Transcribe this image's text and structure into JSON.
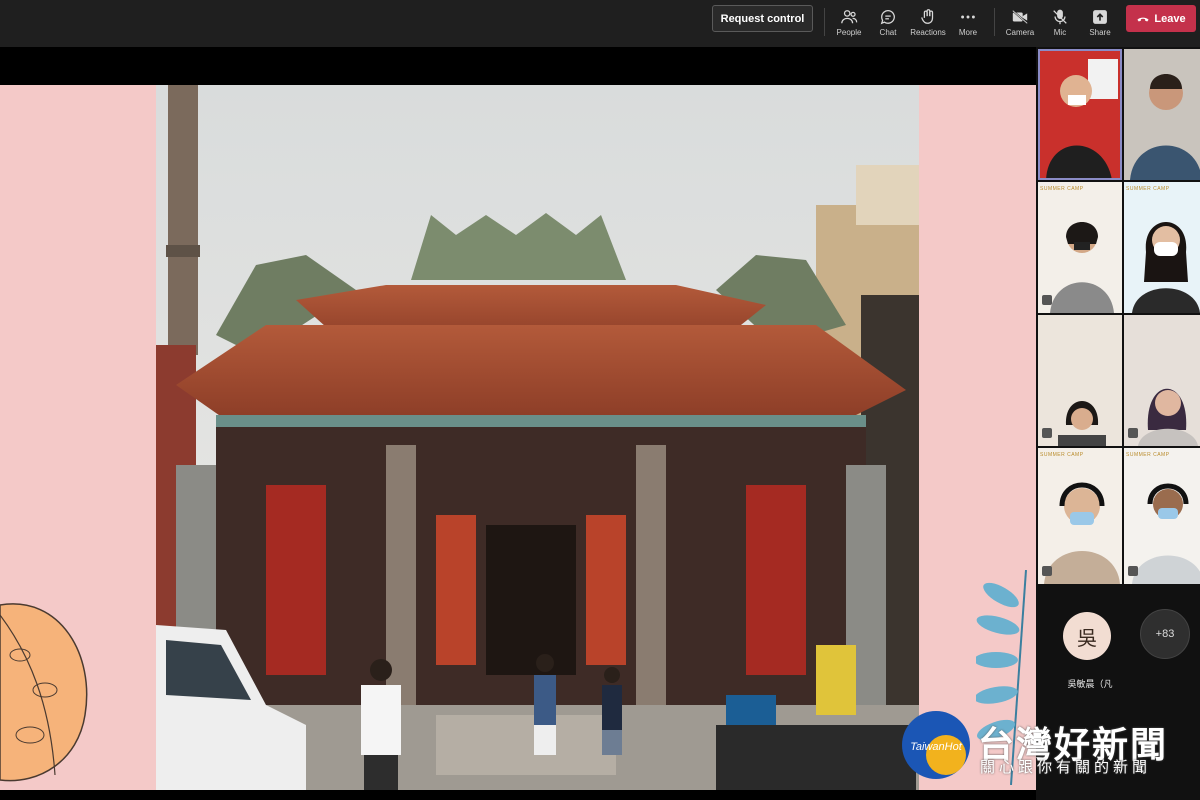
{
  "toolbar": {
    "request_control": "Request control",
    "people": "People",
    "chat": "Chat",
    "reactions": "Reactions",
    "more": "More",
    "camera": "Camera",
    "mic": "Mic",
    "share": "Share",
    "leave": "Leave"
  },
  "gallery": {
    "camp_label": "SUMMER CAMP",
    "avatar_initial": "吳",
    "avatar_name": "吳敏晨（凡",
    "overflow_count": "+83"
  },
  "watermark": {
    "logo_text": "TaiwanHot",
    "title": "台灣好新聞",
    "subtitle": "關心跟你有關的新聞"
  },
  "colors": {
    "leave": "#c4314b",
    "slide_bg": "#f4c9c8",
    "selected_tile": "#8b8cc7"
  }
}
